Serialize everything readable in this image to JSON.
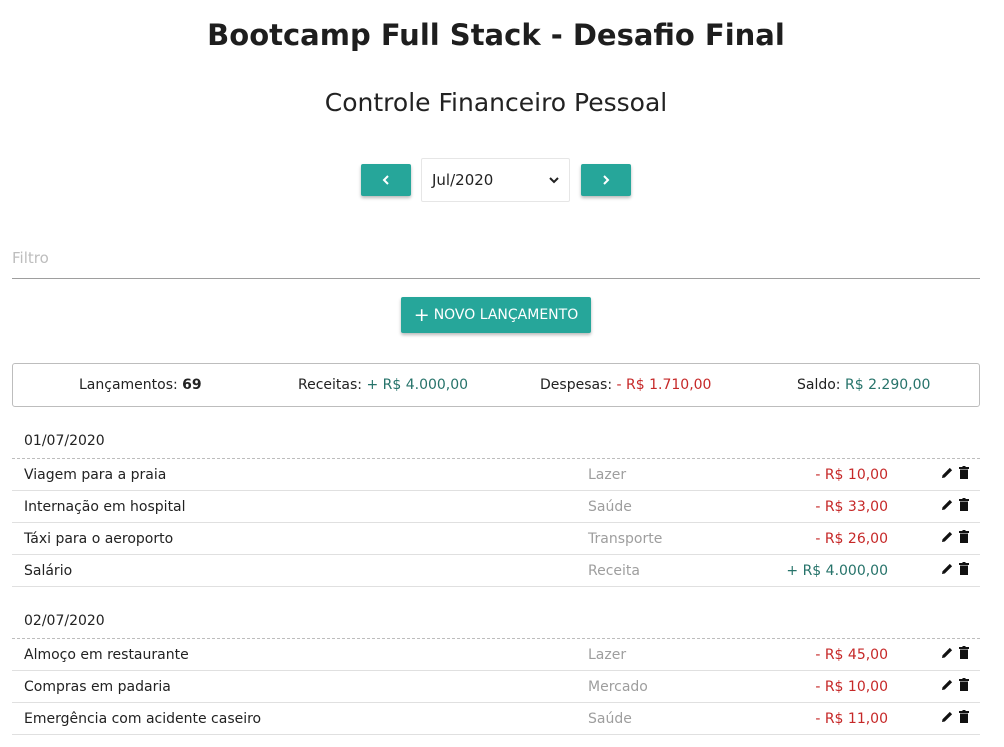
{
  "header": {
    "title": "Bootcamp Full Stack - Desafio Final",
    "subtitle": "Controle Financeiro Pessoal"
  },
  "period": {
    "prev_icon": "chevron-left-icon",
    "next_icon": "chevron-right-icon",
    "selected": "Jul/2020"
  },
  "filter": {
    "placeholder": "Filtro"
  },
  "new_button": {
    "icon": "+",
    "label": "NOVO LANÇAMENTO"
  },
  "summary": {
    "count_label": "Lançamentos: ",
    "count_value": "69",
    "income_label": "Receitas: ",
    "income_value": "+ R$ 4.000,00",
    "expense_label": "Despesas: ",
    "expense_value": "- R$ 1.710,00",
    "balance_label": "Saldo: ",
    "balance_value": "R$ 2.290,00"
  },
  "colors": {
    "accent": "#26a69a",
    "income": "#26736a",
    "expense": "#c62828"
  },
  "groups": [
    {
      "date": "01/07/2020",
      "items": [
        {
          "description": "Viagem para a praia",
          "category": "Lazer",
          "value": "- R$ 10,00",
          "type": "-"
        },
        {
          "description": "Internação em hospital",
          "category": "Saúde",
          "value": "- R$ 33,00",
          "type": "-"
        },
        {
          "description": "Táxi para o aeroporto",
          "category": "Transporte",
          "value": "- R$ 26,00",
          "type": "-"
        },
        {
          "description": "Salário",
          "category": "Receita",
          "value": "+ R$ 4.000,00",
          "type": "+"
        }
      ]
    },
    {
      "date": "02/07/2020",
      "items": [
        {
          "description": "Almoço em restaurante",
          "category": "Lazer",
          "value": "- R$ 45,00",
          "type": "-"
        },
        {
          "description": "Compras em padaria",
          "category": "Mercado",
          "value": "- R$ 10,00",
          "type": "-"
        },
        {
          "description": "Emergência com acidente caseiro",
          "category": "Saúde",
          "value": "- R$ 11,00",
          "type": "-"
        }
      ]
    }
  ],
  "row_icons": {
    "edit": "pencil-icon",
    "delete": "trash-icon"
  }
}
